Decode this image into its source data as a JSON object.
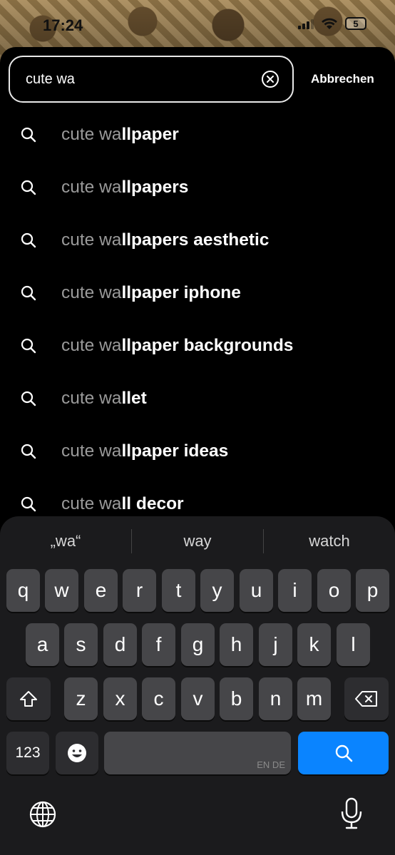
{
  "status": {
    "time": "17:24",
    "battery": "5"
  },
  "search": {
    "value": "cute wa",
    "cancel_label": "Abbrechen"
  },
  "suggestions": [
    {
      "prefix": "cute wa",
      "rest": "llpaper"
    },
    {
      "prefix": "cute wa",
      "rest": "llpapers"
    },
    {
      "prefix": "cute wa",
      "rest": "llpapers aesthetic"
    },
    {
      "prefix": "cute wa",
      "rest": "llpaper iphone"
    },
    {
      "prefix": "cute wa",
      "rest": "llpaper backgrounds"
    },
    {
      "prefix": "cute wa",
      "rest": "llet"
    },
    {
      "prefix": "cute wa",
      "rest": "llpaper ideas"
    },
    {
      "prefix": "cute wa",
      "rest": "ll decor"
    }
  ],
  "keyboard": {
    "predictions": [
      "„wa“",
      "way",
      "watch"
    ],
    "row1": [
      "q",
      "w",
      "e",
      "r",
      "t",
      "y",
      "u",
      "i",
      "o",
      "p"
    ],
    "row2": [
      "a",
      "s",
      "d",
      "f",
      "g",
      "h",
      "j",
      "k",
      "l"
    ],
    "row3": [
      "z",
      "x",
      "c",
      "v",
      "b",
      "n",
      "m"
    ],
    "numbers_label": "123",
    "space_languages": "EN DE"
  },
  "colors": {
    "accent": "#0a84ff",
    "key": "#464649",
    "keyboard_bg": "#1b1b1d"
  }
}
